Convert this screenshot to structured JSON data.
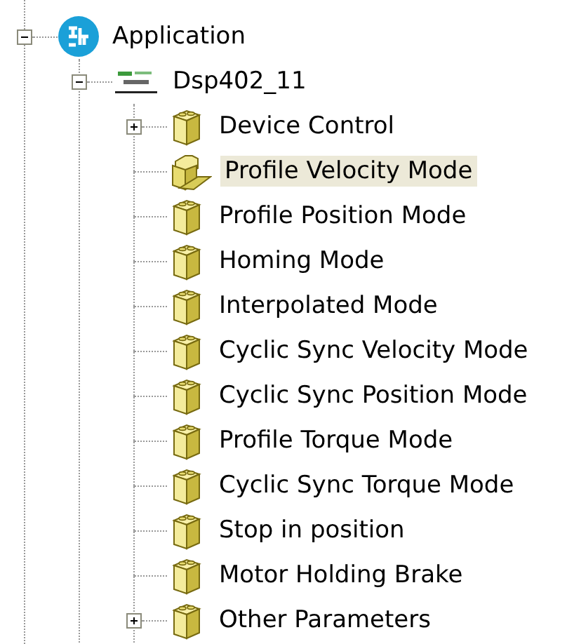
{
  "tree": [
    {
      "label": "Application",
      "kind": "application",
      "expanded": true,
      "selected": false,
      "children": [
        {
          "label": "Dsp402_11",
          "kind": "device",
          "expanded": true,
          "selected": false,
          "children": [
            {
              "label": "Device Control",
              "kind": "folder",
              "expanded": false,
              "selected": false
            },
            {
              "label": "Profile Velocity Mode",
              "kind": "folder",
              "selected": true
            },
            {
              "label": "Profile Position Mode",
              "kind": "folder",
              "selected": false
            },
            {
              "label": "Homing Mode",
              "kind": "folder",
              "selected": false
            },
            {
              "label": "Interpolated Mode",
              "kind": "folder",
              "selected": false
            },
            {
              "label": "Cyclic Sync Velocity Mode",
              "kind": "folder",
              "selected": false
            },
            {
              "label": "Cyclic Sync Position Mode",
              "kind": "folder",
              "selected": false
            },
            {
              "label": "Profile Torque Mode",
              "kind": "folder",
              "selected": false
            },
            {
              "label": "Cyclic Sync Torque Mode",
              "kind": "folder",
              "selected": false
            },
            {
              "label": "Stop in position",
              "kind": "folder",
              "selected": false
            },
            {
              "label": "Motor Holding Brake",
              "kind": "folder",
              "selected": false
            },
            {
              "label": "Other Parameters",
              "kind": "folder",
              "expanded": false,
              "selected": false
            }
          ]
        }
      ]
    }
  ]
}
